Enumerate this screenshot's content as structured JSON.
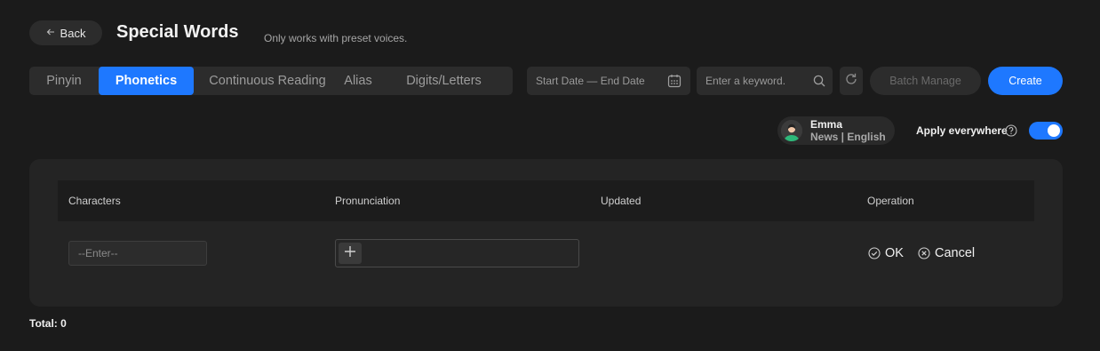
{
  "header": {
    "back_label": "Back",
    "title": "Special Words",
    "subtitle": "Only works with preset voices."
  },
  "tabs": [
    {
      "label": "Pinyin",
      "active": false
    },
    {
      "label": "Phonetics",
      "active": true
    },
    {
      "label": "Continuous Reading",
      "active": false
    },
    {
      "label": "Alias",
      "active": false
    },
    {
      "label": "Digits/Letters",
      "active": false
    }
  ],
  "filters": {
    "date_range": "Start Date — End Date",
    "keyword_placeholder": "Enter a keyword.",
    "batch_label": "Batch Manage",
    "create_label": "Create"
  },
  "voice": {
    "name": "Emma",
    "description": "News | English"
  },
  "apply_everywhere": {
    "label": "Apply everywhere",
    "enabled": true
  },
  "table": {
    "columns": [
      "Characters",
      "Pronunciation",
      "Updated",
      "Operation"
    ],
    "new_row": {
      "characters_placeholder": "--Enter--",
      "ok_label": "OK",
      "cancel_label": "Cancel"
    }
  },
  "footer": {
    "total": "Total: 0"
  },
  "colors": {
    "accent": "#1e78ff",
    "background": "#1b1b1b",
    "surface": "#2c2c2c"
  }
}
